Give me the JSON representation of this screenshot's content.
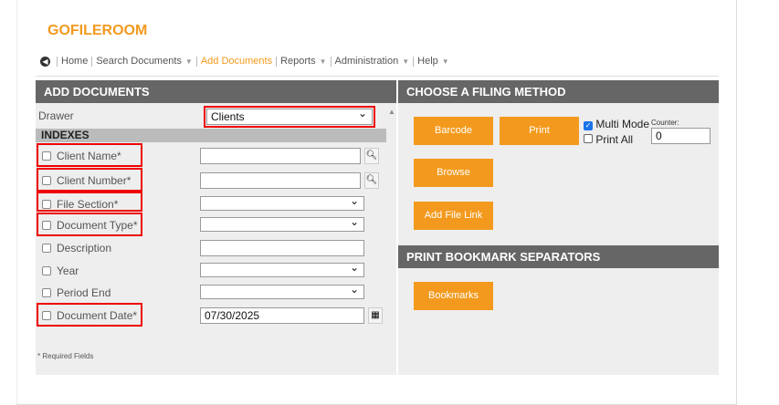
{
  "logo": "GOFILEROOM",
  "nav": {
    "home": "Home",
    "search": "Search Documents",
    "add": "Add Documents",
    "reports": "Reports",
    "admin": "Administration",
    "help": "Help"
  },
  "left": {
    "title": "ADD DOCUMENTS",
    "drawer_label": "Drawer",
    "drawer_value": "Clients",
    "indexes": "INDEXES",
    "fields": [
      {
        "label": "Client Name*",
        "type": "text",
        "value": ""
      },
      {
        "label": "Client Number*",
        "type": "text",
        "value": ""
      },
      {
        "label": "File Section*",
        "type": "select",
        "value": ""
      },
      {
        "label": "Document Type*",
        "type": "select",
        "value": ""
      },
      {
        "label": "Description",
        "type": "text",
        "value": ""
      },
      {
        "label": "Year",
        "type": "select",
        "value": ""
      },
      {
        "label": "Period End",
        "type": "select",
        "value": ""
      },
      {
        "label": "Document Date*",
        "type": "date",
        "value": "07/30/2025"
      }
    ],
    "required_note": "* Required Fields"
  },
  "right": {
    "title": "CHOOSE A FILING METHOD",
    "barcode": "Barcode",
    "print": "Print",
    "multi_mode": "Multi Mode",
    "multi_mode_checked": true,
    "print_all": "Print All",
    "print_all_checked": false,
    "counter_label": "Counter:",
    "counter_value": "0",
    "browse": "Browse",
    "add_file_link": "Add File Link",
    "bookmark_title": "PRINT BOOKMARK SEPARATORS",
    "bookmarks": "Bookmarks"
  },
  "colors": {
    "accent": "#f39a1e",
    "header": "#666666",
    "highlight": "#e00000"
  }
}
